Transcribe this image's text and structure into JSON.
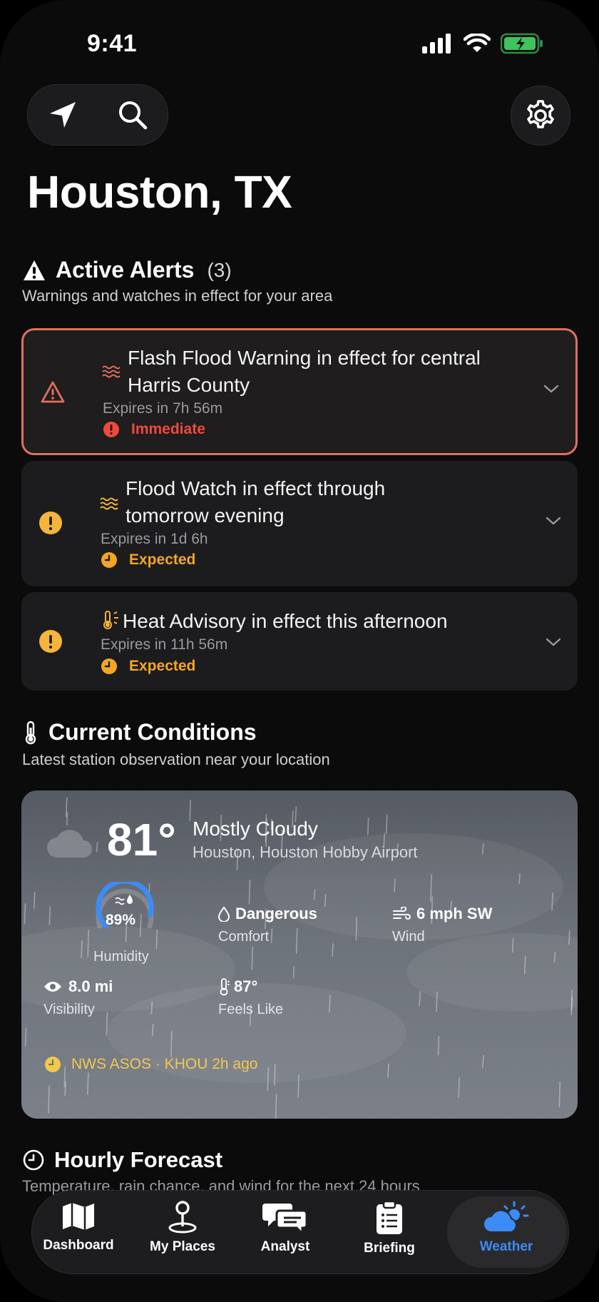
{
  "status": {
    "time": "9:41"
  },
  "location": {
    "city": "Houston, TX"
  },
  "alerts_section": {
    "title": "Active Alerts",
    "count": "(3)",
    "subtitle": "Warnings and watches in effect for your area"
  },
  "alerts": [
    {
      "title_line1": "Flash Flood Warning in effect for central",
      "title_line2": "Harris County",
      "expires": "Expires in 7h 56m",
      "severity": "Immediate",
      "severity_color": "#ef4a3e",
      "type_icon": "flood-waves-icon"
    },
    {
      "title_line1": "Flood Watch in effect through",
      "title_line2": "tomorrow evening",
      "expires": "Expires in 1d 6h",
      "severity": "Expected",
      "severity_color": "#f5a524",
      "type_icon": "flood-waves-icon"
    },
    {
      "title_line1": "Heat Advisory in effect this afternoon",
      "expires": "Expires in 11h 56m",
      "severity": "Expected",
      "severity_color": "#f5a524",
      "type_icon": "thermometer-sun-icon"
    }
  ],
  "conditions_section": {
    "title": "Current Conditions",
    "subtitle": "Latest station observation near your location"
  },
  "conditions": {
    "temp": "81°",
    "summary": "Mostly Cloudy",
    "station": "Houston, Houston Hobby Airport",
    "humidity_value": "89%",
    "humidity_label": "Humidity",
    "humidity_fraction": 0.89,
    "comfort_value": "Dangerous",
    "comfort_label": "Comfort",
    "wind_value": "6 mph SW",
    "wind_label": "Wind",
    "visibility_value": "8.0 mi",
    "visibility_label": "Visibility",
    "feels_value": "87°",
    "feels_label": "Feels Like",
    "source": "NWS ASOS · KHOU 2h ago"
  },
  "hourly_section": {
    "title": "Hourly Forecast",
    "subtitle": "Temperature, rain chance, and wind for the next 24 hours"
  },
  "nav": {
    "items": [
      "Dashboard",
      "My Places",
      "Analyst",
      "Briefing",
      "Weather"
    ],
    "active": "Weather"
  },
  "colors": {
    "accent": "#3b8cf6",
    "alert_border": "#e0705e",
    "immediate": "#ef4a3e",
    "expected": "#f5a524",
    "source": "#f2c94c"
  }
}
